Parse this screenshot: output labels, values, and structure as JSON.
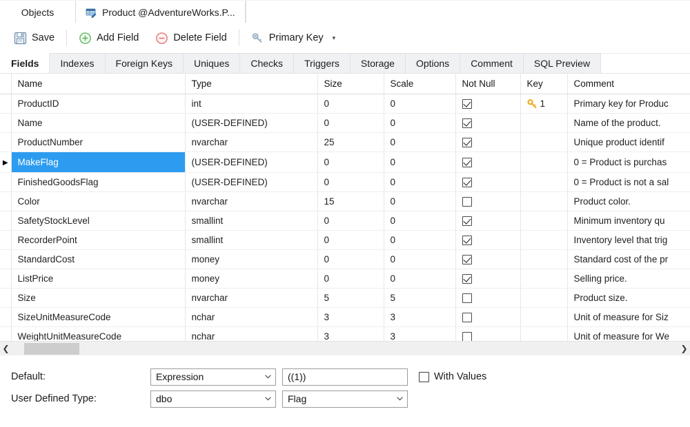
{
  "window_tabs": [
    {
      "label": "Objects",
      "icon": "",
      "active": false
    },
    {
      "label": "Product @AdventureWorks.P...",
      "icon": "table-edit-icon",
      "active": true
    }
  ],
  "toolbar": {
    "save_label": "Save",
    "add_field_label": "Add Field",
    "delete_field_label": "Delete Field",
    "primary_key_label": "Primary Key",
    "caret": "▾"
  },
  "inner_tabs": [
    {
      "label": "Fields",
      "active": true
    },
    {
      "label": "Indexes",
      "active": false
    },
    {
      "label": "Foreign Keys",
      "active": false
    },
    {
      "label": "Uniques",
      "active": false
    },
    {
      "label": "Checks",
      "active": false
    },
    {
      "label": "Triggers",
      "active": false
    },
    {
      "label": "Storage",
      "active": false
    },
    {
      "label": "Options",
      "active": false
    },
    {
      "label": "Comment",
      "active": false
    },
    {
      "label": "SQL Preview",
      "active": false
    }
  ],
  "grid": {
    "columns": [
      "Name",
      "Type",
      "Size",
      "Scale",
      "Not Null",
      "Key",
      "Comment"
    ],
    "rows": [
      {
        "name": "ProductID",
        "type": "int",
        "size": "0",
        "scale": "0",
        "not_null": true,
        "key": "1",
        "key_icon": "key-icon",
        "comment": "Primary key for Produc",
        "selected": false
      },
      {
        "name": "Name",
        "type": "(USER-DEFINED)",
        "size": "0",
        "scale": "0",
        "not_null": true,
        "key": "",
        "key_icon": "",
        "comment": "Name of the product.",
        "selected": false
      },
      {
        "name": "ProductNumber",
        "type": "nvarchar",
        "size": "25",
        "scale": "0",
        "not_null": true,
        "key": "",
        "key_icon": "",
        "comment": "Unique product identif",
        "selected": false
      },
      {
        "name": "MakeFlag",
        "type": "(USER-DEFINED)",
        "size": "0",
        "scale": "0",
        "not_null": true,
        "key": "",
        "key_icon": "",
        "comment": "0 = Product is purchas",
        "selected": true
      },
      {
        "name": "FinishedGoodsFlag",
        "type": "(USER-DEFINED)",
        "size": "0",
        "scale": "0",
        "not_null": true,
        "key": "",
        "key_icon": "",
        "comment": "0 = Product is not a sal",
        "selected": false
      },
      {
        "name": "Color",
        "type": "nvarchar",
        "size": "15",
        "scale": "0",
        "not_null": false,
        "key": "",
        "key_icon": "",
        "comment": "Product color.",
        "selected": false
      },
      {
        "name": "SafetyStockLevel",
        "type": "smallint",
        "size": "0",
        "scale": "0",
        "not_null": true,
        "key": "",
        "key_icon": "",
        "comment": "Minimum inventory qu",
        "selected": false
      },
      {
        "name": "RecorderPoint",
        "type": "smallint",
        "size": "0",
        "scale": "0",
        "not_null": true,
        "key": "",
        "key_icon": "",
        "comment": "Inventory level that trig",
        "selected": false
      },
      {
        "name": "StandardCost",
        "type": "money",
        "size": "0",
        "scale": "0",
        "not_null": true,
        "key": "",
        "key_icon": "",
        "comment": "Standard cost of the pr",
        "selected": false
      },
      {
        "name": "ListPrice",
        "type": "money",
        "size": "0",
        "scale": "0",
        "not_null": true,
        "key": "",
        "key_icon": "",
        "comment": "Selling price.",
        "selected": false
      },
      {
        "name": "Size",
        "type": "nvarchar",
        "size": "5",
        "scale": "5",
        "not_null": false,
        "key": "",
        "key_icon": "",
        "comment": "Product size.",
        "selected": false
      },
      {
        "name": "SizeUnitMeasureCode",
        "type": "nchar",
        "size": "3",
        "scale": "3",
        "not_null": false,
        "key": "",
        "key_icon": "",
        "comment": "Unit of measure for Siz",
        "selected": false
      },
      {
        "name": "WeightUnitMeasureCode",
        "type": "nchar",
        "size": "3",
        "scale": "3",
        "not_null": false,
        "key": "",
        "key_icon": "",
        "comment": "Unit of measure for We",
        "selected": false
      }
    ]
  },
  "scrollbar": {
    "left_arrow": "❮",
    "right_arrow": "❯"
  },
  "bottom_panel": {
    "default_label": "Default:",
    "default_kind": "Expression",
    "default_value": "((1))",
    "with_values_label": "With Values",
    "with_values_checked": false,
    "udt_label": "User Defined Type:",
    "udt_schema": "dbo",
    "udt_name": "Flag"
  },
  "colors": {
    "selection": "#2d9cf0",
    "key_gold": "#f0a81e",
    "add_green": "#5cb85c",
    "delete_red": "#e57373",
    "save_blue": "#4a7ebb"
  }
}
